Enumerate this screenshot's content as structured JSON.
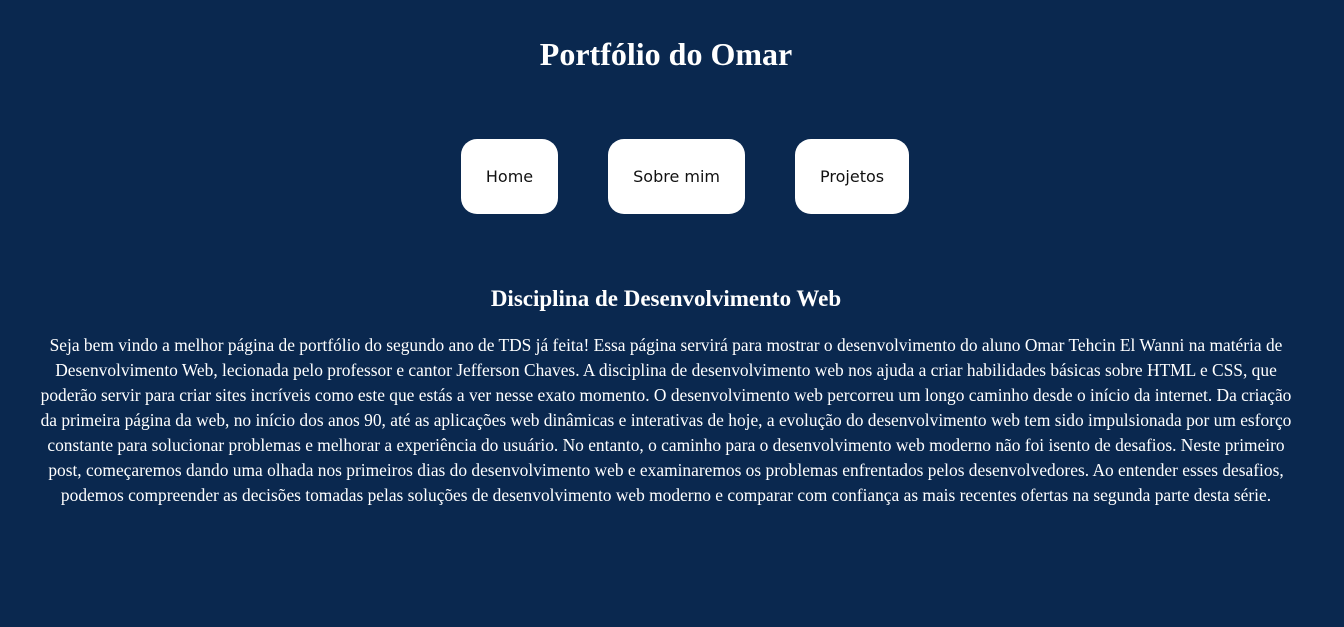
{
  "header": {
    "title": "Portfólio do Omar"
  },
  "nav": {
    "items": [
      {
        "label": "Home"
      },
      {
        "label": "Sobre mim"
      },
      {
        "label": "Projetos"
      }
    ]
  },
  "main": {
    "section_title": "Disciplina de Desenvolvimento Web",
    "paragraph": "Seja bem vindo a melhor página de portfólio do segundo ano de TDS já feita! Essa página servirá para mostrar o desenvolvimento do aluno Omar Tehcin El Wanni na matéria de Desenvolvimento Web, lecionada pelo professor e cantor Jefferson Chaves. A disciplina de desenvolvimento web nos ajuda a criar habilidades básicas sobre HTML e CSS, que poderão servir para criar sites incríveis como este que estás a ver nesse exato momento. O desenvolvimento web percorreu um longo caminho desde o início da internet. Da criação da primeira página da web, no início dos anos 90, até as aplicações web dinâmicas e interativas de hoje, a evolução do desenvolvimento web tem sido impulsionada por um esforço constante para solucionar problemas e melhorar a experiência do usuário. No entanto, o caminho para o desenvolvimento web moderno não foi isento de desafios. Neste primeiro post, começaremos dando uma olhada nos primeiros dias do desenvolvimento web e examinaremos os problemas enfrentados pelos desenvolvedores. Ao entender esses desafios, podemos compreender as decisões tomadas pelas soluções de desenvolvimento web moderno e comparar com confiança as mais recentes ofertas na segunda parte desta série."
  },
  "colors": {
    "background": "#0a284f",
    "button_background": "#ffffff",
    "button_text": "#111111",
    "text": "#ffffff"
  }
}
